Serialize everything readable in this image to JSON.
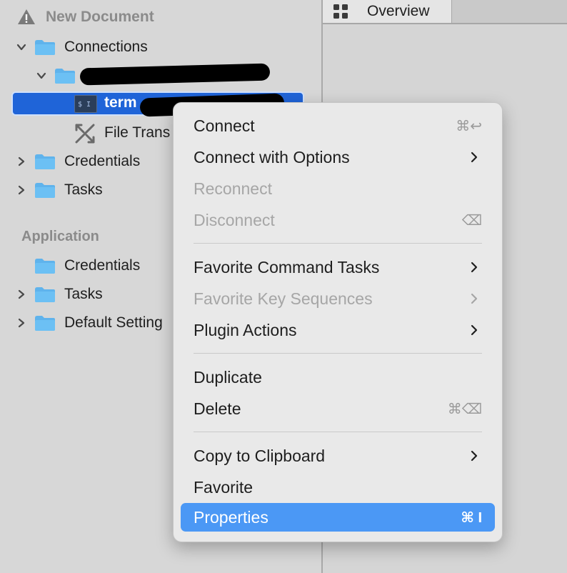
{
  "sidebar": {
    "document_title": "New Document",
    "connections_label": "Connections",
    "connection_child_label": "",
    "selected_item_label": "term",
    "file_transfer_label": "File Trans",
    "credentials_label": "Credentials",
    "tasks_label": "Tasks",
    "application_header": "Application",
    "app_credentials_label": "Credentials",
    "app_tasks_label": "Tasks",
    "app_default_settings_label": "Default Setting"
  },
  "tabs": {
    "overview_label": "Overview"
  },
  "context_menu": {
    "items": [
      {
        "label": "Connect",
        "shortcut": "⌘↩",
        "disabled": false
      },
      {
        "label": "Connect with Options",
        "submenu": true,
        "disabled": false
      },
      {
        "label": "Reconnect",
        "disabled": true
      },
      {
        "label": "Disconnect",
        "shortcut": "⌫",
        "disabled": true
      },
      {
        "label": "Favorite Command Tasks",
        "submenu": true,
        "disabled": false
      },
      {
        "label": "Favorite Key Sequences",
        "submenu": true,
        "disabled": true
      },
      {
        "label": "Plugin Actions",
        "submenu": true,
        "disabled": false
      },
      {
        "label": "Duplicate",
        "disabled": false
      },
      {
        "label": "Delete",
        "shortcut": "⌘⌫",
        "disabled": false
      },
      {
        "label": "Copy to Clipboard",
        "submenu": true,
        "disabled": false
      },
      {
        "label": "Favorite",
        "disabled": false
      },
      {
        "label": "Properties",
        "shortcut": "⌘ I",
        "disabled": false,
        "highlighted": true
      }
    ]
  },
  "colors": {
    "selection_blue": "#1f64d8",
    "menu_highlight": "#4b98f5",
    "folder_blue": "#5fb3ec"
  }
}
